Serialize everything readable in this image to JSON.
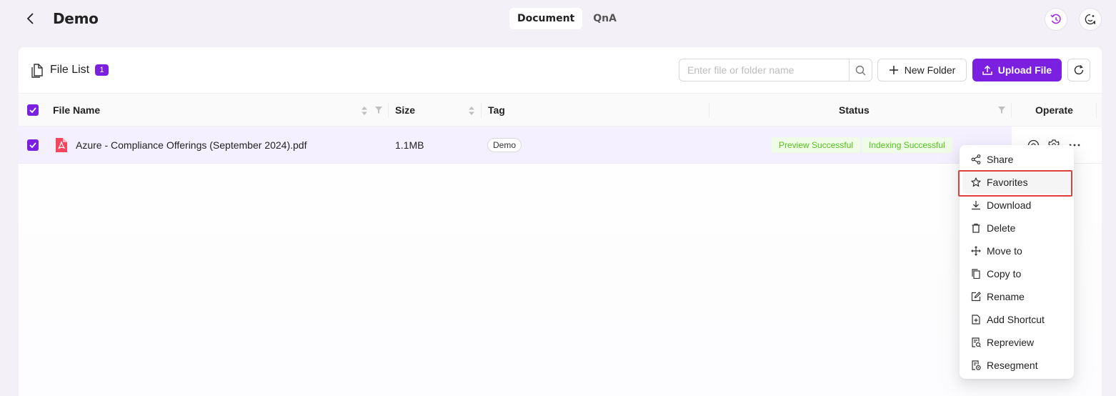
{
  "header": {
    "title": "Demo",
    "tabs": [
      {
        "label": "Document",
        "active": true
      },
      {
        "label": "QnA",
        "active": false
      }
    ]
  },
  "file_list": {
    "title": "File List",
    "count": "1",
    "search_placeholder": "Enter file or folder name",
    "new_folder_label": "New Folder",
    "upload_label": "Upload File"
  },
  "table": {
    "columns": {
      "name": "File Name",
      "size": "Size",
      "tag": "Tag",
      "status": "Status",
      "operate": "Operate"
    },
    "rows": [
      {
        "name": "Azure - Compliance Offerings (September 2024).pdf",
        "size": "1.1MB",
        "tag": "Demo",
        "status_preview": "Preview Successful",
        "status_index": "Indexing Successful"
      }
    ]
  },
  "menu": {
    "items": [
      {
        "label": "Share",
        "icon": "share-icon"
      },
      {
        "label": "Favorites",
        "icon": "star-icon"
      },
      {
        "label": "Download",
        "icon": "download-icon"
      },
      {
        "label": "Delete",
        "icon": "trash-icon"
      },
      {
        "label": "Move to",
        "icon": "move-icon"
      },
      {
        "label": "Copy to",
        "icon": "copy-icon"
      },
      {
        "label": "Rename",
        "icon": "edit-icon"
      },
      {
        "label": "Add Shortcut",
        "icon": "shortcut-icon"
      },
      {
        "label": "Repreview",
        "icon": "repreview-icon"
      },
      {
        "label": "Resegment",
        "icon": "resegment-icon"
      }
    ],
    "highlighted": "Favorites"
  },
  "colors": {
    "accent": "#7b1fe0",
    "success_text": "#52c41a",
    "success_bg": "#f0fbe8",
    "highlight_outline": "#e0403a"
  }
}
